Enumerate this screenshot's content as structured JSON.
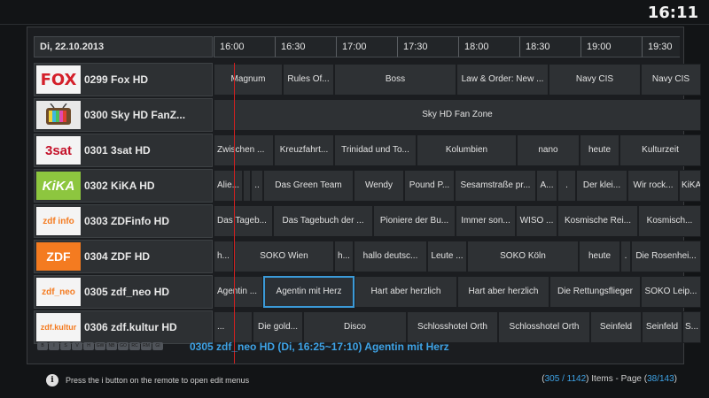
{
  "clock": "16:11",
  "header": {
    "date": "Di, 22.10.2013",
    "times": [
      "16:00",
      "16:30",
      "17:00",
      "17:30",
      "18:00",
      "18:30",
      "19:00",
      "19:30"
    ]
  },
  "channels": [
    {
      "logo": "FOX",
      "name": "0299 Fox HD",
      "programs": [
        {
          "t": "Magnum"
        },
        {
          "t": "Rules Of..."
        },
        {
          "t": "Boss"
        },
        {
          "t": "Law & Order: New ..."
        },
        {
          "t": "Navy CIS"
        },
        {
          "t": "Navy CIS"
        }
      ]
    },
    {
      "logo": "tv",
      "name": "0300 Sky HD FanZ...",
      "programs": [
        {
          "t": "Sky HD Fan Zone"
        }
      ]
    },
    {
      "logo": "3sat",
      "name": "0301 3sat HD",
      "programs": [
        {
          "t": "Zwischen ..."
        },
        {
          "t": "Kreuzfahrt..."
        },
        {
          "t": "Trinidad und To..."
        },
        {
          "t": "Kolumbien"
        },
        {
          "t": "nano"
        },
        {
          "t": "heute"
        },
        {
          "t": "Kulturzeit"
        }
      ]
    },
    {
      "logo": "KiKA",
      "name": "0302 KiKA HD",
      "programs": [
        {
          "t": "Alie..."
        },
        {
          "t": ""
        },
        {
          "t": ".."
        },
        {
          "t": "Das Green Team"
        },
        {
          "t": "Wendy"
        },
        {
          "t": "Pound P..."
        },
        {
          "t": "Sesamstraße pr..."
        },
        {
          "t": "A..."
        },
        {
          "t": "."
        },
        {
          "t": "Der klei..."
        },
        {
          "t": "Wir rock..."
        },
        {
          "t": "KiKA"
        }
      ]
    },
    {
      "logo": "zdf info",
      "name": "0303 ZDFinfo HD",
      "programs": [
        {
          "t": "Das Tageb..."
        },
        {
          "t": "Das Tagebuch der ..."
        },
        {
          "t": "Pioniere der Bu..."
        },
        {
          "t": "Immer son..."
        },
        {
          "t": "WISO ..."
        },
        {
          "t": "Kosmische Rei..."
        },
        {
          "t": "Kosmisch..."
        }
      ]
    },
    {
      "logo": "ZDF",
      "name": "0304 ZDF HD",
      "programs": [
        {
          "t": "h..."
        },
        {
          "t": "SOKO Wien"
        },
        {
          "t": "h..."
        },
        {
          "t": "hallo deutsc..."
        },
        {
          "t": "Leute ..."
        },
        {
          "t": "SOKO Köln"
        },
        {
          "t": "heute"
        },
        {
          "t": "."
        },
        {
          "t": "Die Rosenhei..."
        }
      ]
    },
    {
      "logo": "zdf_neo",
      "name": "0305 zdf_neo HD",
      "programs": [
        {
          "t": "Agentin ..."
        },
        {
          "t": "Agentin mit Herz"
        },
        {
          "t": "Hart aber herzlich"
        },
        {
          "t": "Hart aber herzlich"
        },
        {
          "t": "Die Rettungsflieger"
        },
        {
          "t": "SOKO Leip..."
        }
      ]
    },
    {
      "logo": "zdf.kultur",
      "name": "0306 zdf.kultur HD",
      "programs": [
        {
          "t": "..."
        },
        {
          "t": "Die gold..."
        },
        {
          "t": "Disco"
        },
        {
          "t": "Schlosshotel Orth"
        },
        {
          "t": "Schlosshotel Orth"
        },
        {
          "t": "Seinfeld"
        },
        {
          "t": "Seinfeld"
        },
        {
          "t": "S..."
        }
      ]
    }
  ],
  "selected_info": "0305 zdf_neo HD (Di, 16:25~17:10) Agentin mit Herz",
  "info_buttons": [
    "B",
    "I",
    "S",
    "V",
    "H",
    "GW",
    "NB",
    "GO",
    "RC",
    "RM",
    "GI"
  ],
  "footer": {
    "hint": "Press the i button on the remote to open edit menus",
    "items_open": "(",
    "items_current": "305",
    "items_sep": " / ",
    "items_total": "1142",
    "items_mid": ") Items - Page (",
    "page_current": "38",
    "page_sep": "/",
    "page_total": "143",
    "page_close": ")"
  },
  "colors": {
    "accent": "#3ea3e6",
    "now_line": "#d02020",
    "fox_red": "#d4202a"
  }
}
